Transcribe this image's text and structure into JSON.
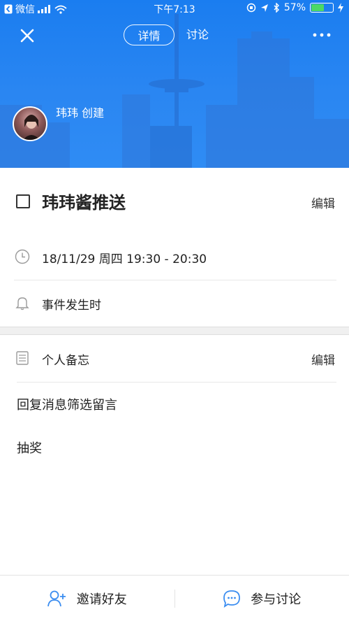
{
  "status_bar": {
    "back_app": "微信",
    "time": "下午7:13",
    "battery": "57%"
  },
  "nav": {
    "tabs": [
      "详情",
      "讨论"
    ]
  },
  "header": {
    "creator": "玮玮 创建"
  },
  "event": {
    "title": "玮玮酱推送",
    "edit_label": "编辑",
    "datetime": "18/11/29 周四 19:30 - 20:30",
    "reminder": "事件发生时"
  },
  "notes": {
    "heading": "个人备忘",
    "edit_label": "编辑",
    "lines": [
      "回复消息筛选留言",
      "抽奖"
    ]
  },
  "bottom_bar": {
    "invite": "邀请好友",
    "discuss": "参与讨论"
  },
  "colors": {
    "accent": "#2a86f2",
    "icon_blue": "#3b8df0"
  },
  "icons": [
    "close-icon",
    "more-icon",
    "clock-icon",
    "bell-icon",
    "notes-icon",
    "add-user-icon",
    "chat-icon"
  ]
}
